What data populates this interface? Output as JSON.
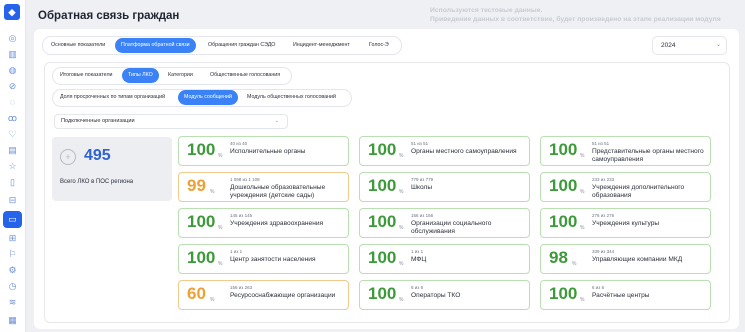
{
  "header": {
    "title": "Обратная связь граждан",
    "notice_line1": "Используются тестовые данные.",
    "notice_line2": "Приведение данных в соответствие, будет произведено на этапе реализации модуля"
  },
  "tabs_level1": [
    "Основные показатели",
    "Платформа обратной связи",
    "Обращения граждан СЭДО",
    "Инцидент-менеджмент",
    "Голос-Э"
  ],
  "year": "2024",
  "tabs_level2": [
    "Итоговые показатели",
    "Типы ЛКО",
    "Категории",
    "Общественные голосования"
  ],
  "tabs_level3": [
    "Доля просроченных по типам организаций",
    "Модуль сообщений",
    "Модуль общественных голосований"
  ],
  "filter": {
    "label": "Подключенные организации"
  },
  "total": {
    "value": "495",
    "label": "Всего ЛКО в ПОС региона"
  },
  "tiles": [
    {
      "pct": "100",
      "count": "40 из 40",
      "name": "Исполнительные органы",
      "status": "ok"
    },
    {
      "pct": "100",
      "count": "51 из 51",
      "name": "Органы местного самоуправления",
      "status": "ok"
    },
    {
      "pct": "100",
      "count": "51 из 51",
      "name": "Представительные органы местного самоуправления",
      "status": "ok"
    },
    {
      "pct": "99",
      "count": "1 098 из 1 108",
      "name": "Дошкольные образовательные учреждения (детские сады)",
      "status": "warn"
    },
    {
      "pct": "100",
      "count": "779 из 779",
      "name": "Школы",
      "status": "ok"
    },
    {
      "pct": "100",
      "count": "233 из 233",
      "name": "Учреждения дополнительного образования",
      "status": "ok"
    },
    {
      "pct": "100",
      "count": "145 из 145",
      "name": "Учреждения здравоохранения",
      "status": "ok"
    },
    {
      "pct": "100",
      "count": "156 из 156",
      "name": "Организации социального обслуживания",
      "status": "ok"
    },
    {
      "pct": "100",
      "count": "276 из 276",
      "name": "Учреждения культуры",
      "status": "ok"
    },
    {
      "pct": "100",
      "count": "1 из 1",
      "name": "Центр занятости населения",
      "status": "ok"
    },
    {
      "pct": "100",
      "count": "1 из 1",
      "name": "МФЦ",
      "status": "ok"
    },
    {
      "pct": "98",
      "count": "339 из 344",
      "name": "Управляющие компании МКД",
      "status": "ok"
    },
    {
      "pct": "60",
      "count": "156 из 263",
      "name": "Ресурсоснабжающие организации",
      "status": "warn"
    },
    {
      "pct": "100",
      "count": "6 из 6",
      "name": "Операторы ТКО",
      "status": "ok"
    },
    {
      "pct": "100",
      "count": "6 из 6",
      "name": "Расчётные центры",
      "status": "ok"
    }
  ],
  "pct_sign": "%",
  "colors": {
    "accent": "#3b82f6",
    "ok": "#3d9a3a",
    "warn": "#f0a030"
  }
}
